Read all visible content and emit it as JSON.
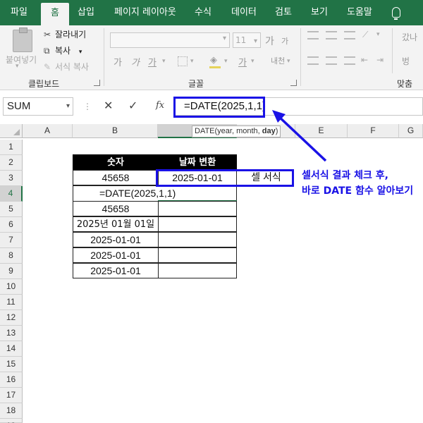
{
  "ribbon_tabs": [
    "파일",
    "홈",
    "삽입",
    "페이지 레이아웃",
    "수식",
    "데이터",
    "검토",
    "보기",
    "도움말"
  ],
  "ribbon": {
    "clipboard": {
      "paste_label": "붙여넣기",
      "cut_label": "잘라내기",
      "copy_label": "복사",
      "format_painter_label": "서식 복사",
      "group_label": "클립보드"
    },
    "font": {
      "size_value": "11",
      "grow_font": "가",
      "shrink_font": "가",
      "bold": "가",
      "italic": "가",
      "underline": "가",
      "phonetic": "내천",
      "group_label": "글꼴"
    },
    "alignment": {
      "group_label": "맞춤",
      "wrap_text": "갔나",
      "merge": "벙"
    }
  },
  "formula_bar": {
    "name_box": "SUM",
    "cancel_icon": "x-icon",
    "enter_icon": "check-icon",
    "fx_label": "fx",
    "formula": "=DATE(2025,1,1)",
    "tooltip_prefix": "DATE(year, month, ",
    "tooltip_bold": "day",
    "tooltip_suffix": ")"
  },
  "grid": {
    "columns": [
      "A",
      "B",
      "C",
      "D",
      "E",
      "F",
      "G"
    ],
    "selected_column": "C",
    "rows": [
      "1",
      "2",
      "3",
      "4",
      "5",
      "6",
      "7",
      "8",
      "9",
      "10",
      "11",
      "12",
      "13",
      "14",
      "15",
      "16",
      "17",
      "18",
      "19"
    ],
    "selected_row": "4"
  },
  "table": {
    "header_number": "숫자",
    "header_date": "날짜 변환",
    "b3": "45658",
    "c3": "2025-01-01",
    "d3": "셀 서식",
    "b4": "=DATE(2025,1,1)",
    "b5": "45658",
    "b6": "2025년 01월 01일",
    "b7": "2025-01-01",
    "b8": "2025-01-01",
    "b9": "2025-01-01"
  },
  "annotation": {
    "line1": "셀서식 결과 체크 후,",
    "line2": "바로 DATE 함수 알아보기",
    "color": "#1a12e6"
  },
  "theme": {
    "excel_green": "#217346"
  }
}
